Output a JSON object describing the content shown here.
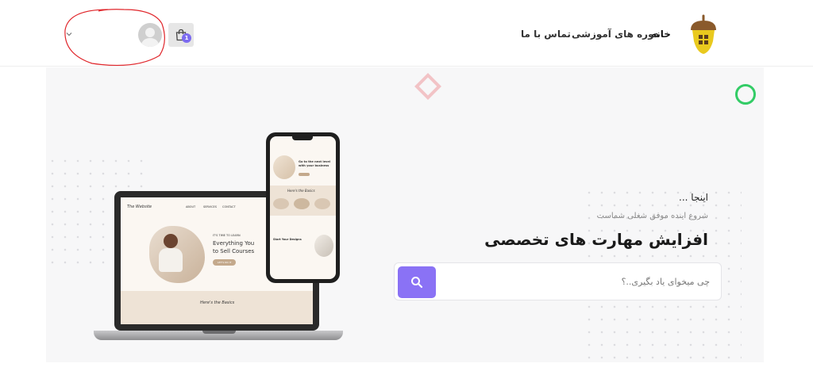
{
  "header": {
    "nav": {
      "home": "خانه",
      "courses": "دوره های آموزشی",
      "contact": "تماس با ما"
    },
    "cart": {
      "badge_count": "1"
    }
  },
  "hero": {
    "intro": "اینجا ...",
    "subtitle": "شروع اینده موفق شغلی شماست",
    "title": "افزایش مهارت های تخصصی",
    "search": {
      "placeholder": "چی میخوای یاد بگیری..؟",
      "value": ""
    }
  },
  "mockup": {
    "laptop": {
      "nav_items": [
        "ABOUT",
        "SERVICES",
        "CONTACT"
      ],
      "tagline": "IT'S TIME TO LEARN",
      "headline_line1": "Everything You",
      "headline_line2": "to Sell Courses",
      "cta": "LET'S DO IT",
      "footer_script": "Here's the Basics"
    },
    "phone": {
      "headline": "Go to the next level with your business",
      "section_script": "Here's the Basics",
      "card_text": "Start Your Designs"
    }
  },
  "colors": {
    "accent": "#8a72f5",
    "badge": "#7c6bf0",
    "ring": "#33cc66",
    "diamond": "#f2c3c6",
    "annotation": "#e0262b",
    "logo_acorn": "#e9c91e"
  }
}
